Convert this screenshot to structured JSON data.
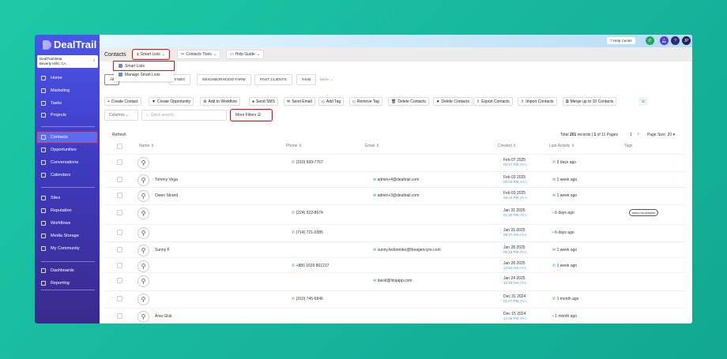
{
  "app": {
    "logo": "DealTrail",
    "location_name": "DealTrail Beta",
    "location_city": "Beverly Hills, CA"
  },
  "sidebar": {
    "items": [
      {
        "label": "Home"
      },
      {
        "label": "Marketing"
      },
      {
        "label": "Tasks"
      },
      {
        "label": "Projects"
      },
      {
        "label": "Contacts",
        "active": true
      },
      {
        "label": "Opportunities"
      },
      {
        "label": "Conversations"
      },
      {
        "label": "Calendars"
      },
      {
        "label": "Sites"
      },
      {
        "label": "Reputation"
      },
      {
        "label": "Workflows"
      },
      {
        "label": "Media Storage"
      },
      {
        "label": "My Community"
      },
      {
        "label": "Dashboards"
      },
      {
        "label": "Reporting"
      }
    ]
  },
  "topbar": {
    "help_center": "? Help Center",
    "avatar": "JP"
  },
  "header": {
    "title": "Contacts",
    "smart_lists": "Smart Lists",
    "contacts_tools": "Contacts Tools",
    "help_guide": "Help Guide"
  },
  "smart_menu": {
    "items": [
      "Smart Lists",
      "Manage Smart Lists"
    ]
  },
  "tabs": [
    "All",
    "FSBO",
    "NEIGHBORHOOD FARM",
    "PAST CLIENTS",
    "IHAB",
    "More"
  ],
  "actions": [
    "Create Contact",
    "Create Opportunity",
    "Add to Workflow",
    "Send SMS",
    "Send Email",
    "Add Tag",
    "Remove Tag",
    "Delete Contacts",
    "Delete Contacts",
    "Export Contacts",
    "Import Contacts",
    "Merge up to 10 Contacts"
  ],
  "controls": {
    "columns": "Columns",
    "search_placeholder": "Quick search",
    "more_filters": "More Filters",
    "refresh": "Refresh"
  },
  "pagination": {
    "total_prefix": "Total",
    "total": "201",
    "total_suffix": "records |",
    "page": "1",
    "of_pages": "of 11 Pages",
    "current": "1",
    "page_size": "Page Size: 20"
  },
  "columns": [
    "Name",
    "Phone",
    "Email",
    "Created",
    "Last Activity",
    "Tags"
  ],
  "accent": "#2a8be0",
  "highlight": "#e0161f",
  "rows": [
    {
      "name": "",
      "phone": "(310) 699-7767",
      "email": "",
      "date": "Feb 07 2025",
      "time": "05:27 PM",
      "tz": "(PST)",
      "activity_icon": "phone",
      "activity": "3 days ago",
      "tag": ""
    },
    {
      "name": "Tommy Vega",
      "phone": "",
      "email": "admin+4@dealtrail.com",
      "date": "Feb 03 2025",
      "time": "09:03 PM",
      "tz": "(PST)",
      "activity_icon": "email",
      "activity": "1 week ago",
      "tag": ""
    },
    {
      "name": "Owen Strand",
      "phone": "",
      "email": "admin+3@dealtrail.com",
      "date": "Feb 03 2025",
      "time": "08:44 PM",
      "tz": "(PST)",
      "activity_icon": "email",
      "activity": "1 week ago",
      "tag": ""
    },
    {
      "name": "",
      "phone": "(224) 522-8674",
      "email": "",
      "date": "Jan 31 2025",
      "time": "01:20 PM",
      "tz": "(PST)",
      "activity_icon": "sms",
      "activity": "6 days ago",
      "tag": "wavv-no-answer"
    },
    {
      "name": "",
      "phone": "(714) 721-0385",
      "email": "",
      "date": "Jan 31 2025",
      "time": "08:47 AM",
      "tz": "(PST)",
      "activity_icon": "sms",
      "activity": "6 days ago",
      "tag": ""
    },
    {
      "name": "Sunny F",
      "phone": "",
      "email": "sunny.fedorenko@theagencyre.com",
      "date": "Jan 28 2025",
      "time": "06:18 PM",
      "tz": "(PST)",
      "activity_icon": "email",
      "activity": "1 week ago",
      "tag": ""
    },
    {
      "name": "",
      "phone": "+880 1639 801217",
      "email": "",
      "date": "Jan 28 2025",
      "time": "12:54 AM",
      "tz": "(PST)",
      "activity_icon": "phone",
      "activity": "1 week ago",
      "tag": ""
    },
    {
      "name": "",
      "phone": "",
      "email": "david@linqapp.com",
      "date": "Jan 24 2025",
      "time": "10:15 AM",
      "tz": "(PST)",
      "activity_icon": "",
      "activity": "",
      "tag": ""
    },
    {
      "name": "",
      "phone": "(310) 745-6846",
      "email": "",
      "date": "Dec 31 2024",
      "time": "01:07 PM",
      "tz": "(PST)",
      "activity_icon": "phone",
      "activity": "1 month ago",
      "tag": ""
    },
    {
      "name": "Ania Gluk",
      "phone": "",
      "email": "",
      "date": "Dec 15 2024",
      "time": "12:46 PM",
      "tz": "(PST)",
      "activity_icon": "sms",
      "activity": "1 month ago",
      "tag": ""
    }
  ]
}
